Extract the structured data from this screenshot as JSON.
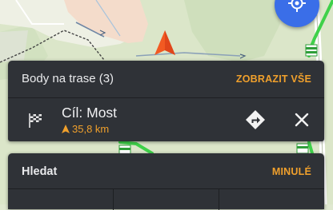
{
  "route_points": {
    "title": "Body na trase (3)",
    "action_label": "ZOBRAZIT VŠE",
    "point": {
      "name": "Cíl: Most",
      "distance": "35,8 km"
    }
  },
  "search": {
    "title": "Hledat",
    "action_label": "MINULÉ"
  },
  "colors": {
    "accent": "#f0a02c",
    "panel": "#2f3237",
    "locate_button": "#3a6ee8",
    "route_line": "#3fd14a",
    "position_marker": "#f25a22"
  },
  "icons": {
    "locate": "crosshair-icon",
    "position": "position-arrow-icon",
    "flag": "finish-flag-icon",
    "distance": "direction-arrow-icon",
    "navigate": "navigate-diamond-icon",
    "close": "close-icon"
  }
}
